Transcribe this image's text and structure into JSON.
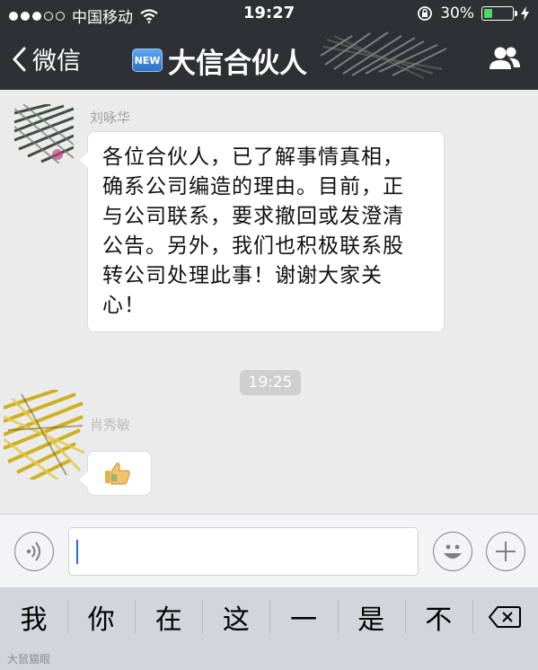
{
  "status_bar": {
    "carrier": "中国移动",
    "time": "19:27",
    "battery_percent": "30%",
    "battery_level": 0.3,
    "icons": [
      "signal-dots-icon",
      "wifi-icon",
      "rotation-lock-icon",
      "battery-icon",
      "charging-bolt-icon"
    ]
  },
  "nav": {
    "back_label": "微信",
    "badge": "NEW",
    "title": "大信合伙人",
    "icons": [
      "chevron-left-icon",
      "group-members-icon"
    ]
  },
  "chat": {
    "messages": [
      {
        "sender": "刘咏华",
        "text_lines": [
          "各位合伙人，已了解事情真相，",
          "确系公司编造的理由。目前，正",
          "与公司联系，要求撤回或发澄清",
          "公告。另外，我们也积极联系股",
          "转公司处理此事！谢谢大家关",
          "心！"
        ]
      },
      {
        "sender": "肖秀敏",
        "content_icon": "thumbs-up-icon"
      }
    ],
    "timestamp": "19:25"
  },
  "input_bar": {
    "icons": [
      "voice-icon",
      "emoji-icon",
      "plus-icon"
    ],
    "value": ""
  },
  "candidates": {
    "items": [
      "我",
      "你",
      "在",
      "这",
      "一",
      "是",
      "不"
    ],
    "delete_icon": "backspace-icon"
  },
  "watermark": "大鼠猫眼"
}
